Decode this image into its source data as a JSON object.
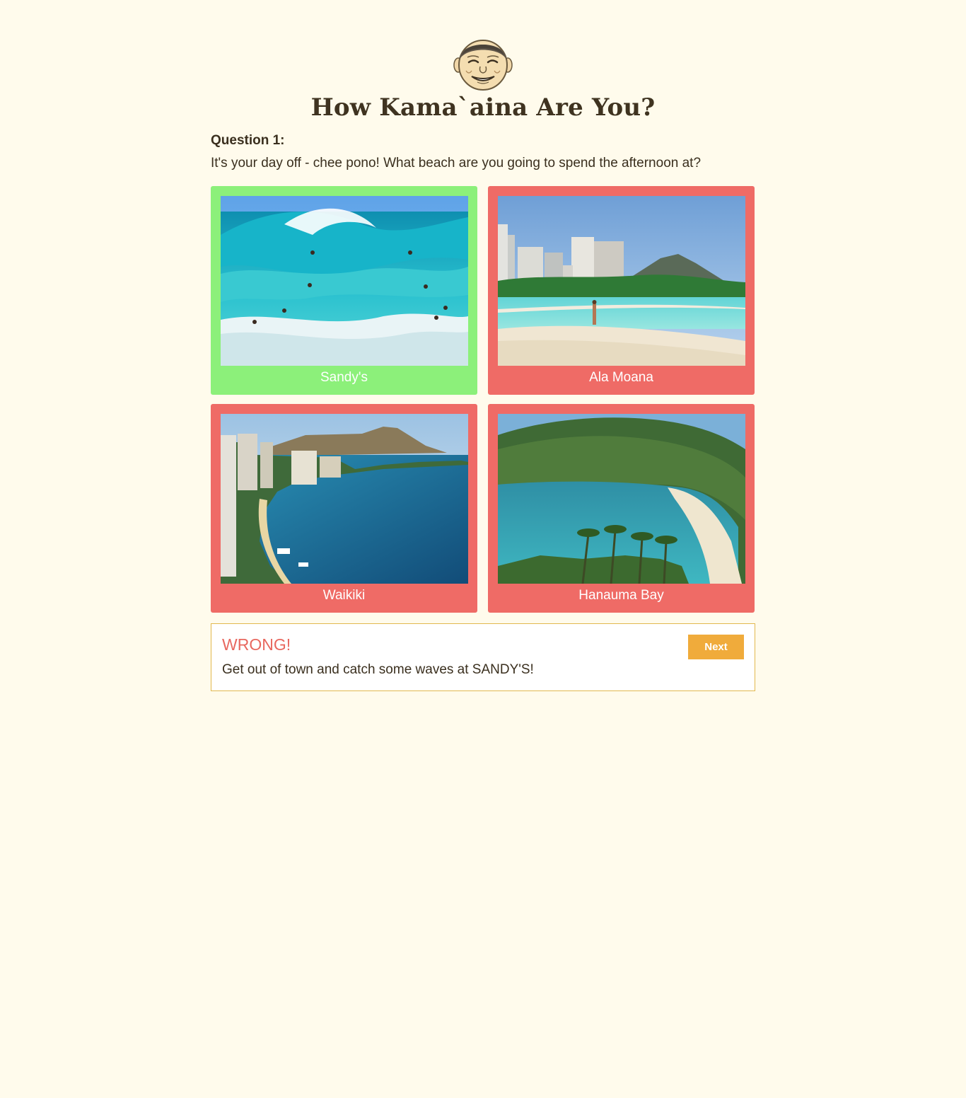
{
  "header": {
    "mascot_icon": "smiling-face-mascot-icon",
    "title": "How Kama`aina Are You?"
  },
  "question": {
    "label": "Question 1:",
    "text": "It's your day off - chee pono! What beach are you going to spend the afternoon at?"
  },
  "choices": [
    {
      "label": "Sandy's",
      "state": "correct",
      "scene": "big-wave-surf-beach"
    },
    {
      "label": "Ala Moana",
      "state": "wrong",
      "scene": "city-beach-with-highrises"
    },
    {
      "label": "Waikiki",
      "state": "wrong",
      "scene": "aerial-bay-with-diamond-head"
    },
    {
      "label": "Hanauma Bay",
      "state": "wrong",
      "scene": "crater-bay-with-palms"
    }
  ],
  "feedback": {
    "title": "WRONG!",
    "text": "Get out of town and catch some waves at SANDY'S!",
    "next_label": "Next"
  },
  "colors": {
    "background": "#fffbec",
    "correct": "#8cf07a",
    "wrong": "#ef6b66",
    "accent": "#f0ab3b",
    "feedback_title": "#e8685f"
  }
}
